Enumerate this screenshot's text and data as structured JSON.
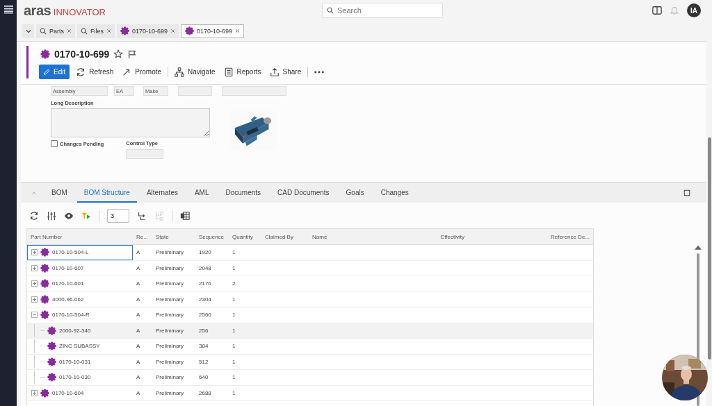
{
  "header": {
    "brand": "aras",
    "product": "INNOVATOR",
    "search": {
      "placeholder": "Search"
    },
    "avatar": "IA"
  },
  "open_tabs": [
    {
      "kind": "search",
      "label": "Parts",
      "selected": false
    },
    {
      "kind": "search",
      "label": "Files",
      "selected": false
    },
    {
      "kind": "part",
      "label": "0170-10-699",
      "selected": false
    },
    {
      "kind": "part",
      "label": "0170-10-699",
      "selected": true
    }
  ],
  "item": {
    "title": "0170-10-699",
    "actions": [
      {
        "kind": "edit",
        "label": "Edit"
      },
      {
        "kind": "refresh",
        "label": "Refresh"
      },
      {
        "kind": "promote",
        "label": "Promote"
      },
      {
        "kind": "navigate",
        "label": "Navigate"
      },
      {
        "kind": "reports",
        "label": "Reports"
      },
      {
        "kind": "share",
        "label": "Share"
      },
      {
        "kind": "more"
      }
    ]
  },
  "form": {
    "fields": [
      {
        "value": "Assembly"
      },
      {
        "value": "EA"
      },
      {
        "value": "Make"
      }
    ],
    "long_description": {
      "label": "Long Description"
    },
    "changes_pending": {
      "label": "Changes Pending",
      "checked": false
    },
    "control_type": {
      "label": "Control Type"
    }
  },
  "relationship_tabs": [
    {
      "label": "BOM",
      "selected": false
    },
    {
      "label": "BOM Structure",
      "selected": true
    },
    {
      "label": "Alternates",
      "selected": false
    },
    {
      "label": "AML",
      "selected": false
    },
    {
      "label": "Documents",
      "selected": false
    },
    {
      "label": "CAD Documents",
      "selected": false
    },
    {
      "label": "Goals",
      "selected": false
    },
    {
      "label": "Changes",
      "selected": false
    }
  ],
  "grid_toolbar": {
    "depth": "3"
  },
  "table": {
    "columns": [
      "Part Number",
      "Re...",
      "State",
      "Sequence",
      "Quantity",
      "Claimed By",
      "Name",
      "Effectivity",
      "Reference De..."
    ],
    "rows": [
      {
        "part_number": "0170-10-504-L",
        "rev": "A",
        "state": "Preliminary",
        "sequence": "1920",
        "quantity": "1",
        "expanded": false,
        "selected": true,
        "hovered": false
      },
      {
        "part_number": "0170-10-607",
        "rev": "A",
        "state": "Preliminary",
        "sequence": "2048",
        "quantity": "1",
        "expanded": false,
        "selected": false,
        "hovered": false
      },
      {
        "part_number": "0170-10-601",
        "rev": "A",
        "state": "Preliminary",
        "sequence": "2176",
        "quantity": "2",
        "expanded": false,
        "selected": false,
        "hovered": false
      },
      {
        "part_number": "4000-96-062",
        "rev": "A",
        "state": "Preliminary",
        "sequence": "2304",
        "quantity": "1",
        "expanded": false,
        "selected": false,
        "hovered": false
      },
      {
        "part_number": "0170-10-504-R",
        "rev": "A",
        "state": "Preliminary",
        "sequence": "2560",
        "quantity": "1",
        "expanded": true,
        "selected": false,
        "hovered": false,
        "children": [
          {
            "part_number": "2000-92-340",
            "rev": "A",
            "state": "Preliminary",
            "sequence": "256",
            "quantity": "1",
            "selected": false,
            "hovered": true
          },
          {
            "part_number": "ZINC SUBASSY",
            "rev": "A",
            "state": "Preliminary",
            "sequence": "384",
            "quantity": "1",
            "selected": false,
            "hovered": false
          },
          {
            "part_number": "0170-10-031",
            "rev": "A",
            "state": "Preliminary",
            "sequence": "512",
            "quantity": "1",
            "selected": false,
            "hovered": false
          },
          {
            "part_number": "0170-10-030",
            "rev": "A",
            "state": "Preliminary",
            "sequence": "640",
            "quantity": "1",
            "selected": false,
            "hovered": false
          }
        ]
      },
      {
        "part_number": "0170-10-604",
        "rev": "A",
        "state": "Preliminary",
        "sequence": "2688",
        "quantity": "1",
        "expanded": false,
        "selected": false,
        "hovered": false
      }
    ]
  }
}
